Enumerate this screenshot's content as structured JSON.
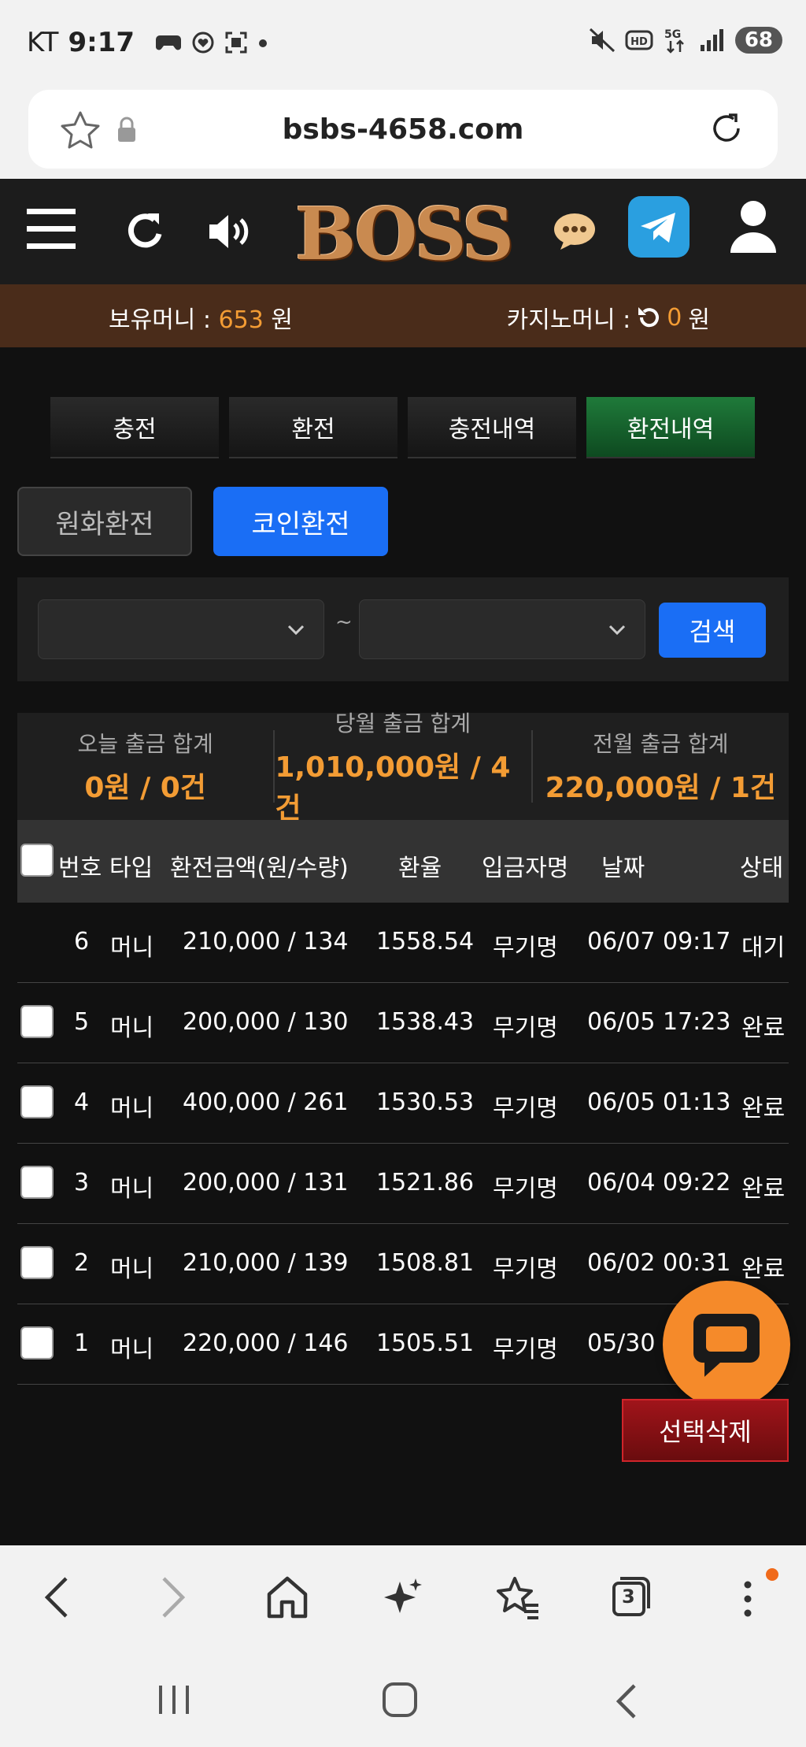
{
  "status_bar": {
    "carrier": "KT",
    "time": "9:17",
    "battery": "68"
  },
  "browser": {
    "url": "bsbs-4658.com",
    "tab_count": "3"
  },
  "header": {
    "logo_text": "BOSS"
  },
  "money": {
    "held_label": "보유머니 :",
    "held_value": "653",
    "held_unit": "원",
    "casino_label": "카지노머니 :",
    "casino_value": "0",
    "casino_unit": "원"
  },
  "tabs": [
    {
      "label": "충전",
      "active": false
    },
    {
      "label": "환전",
      "active": false
    },
    {
      "label": "충전내역",
      "active": false
    },
    {
      "label": "환전내역",
      "active": true
    }
  ],
  "subtabs": [
    {
      "label": "원화환전",
      "active": false
    },
    {
      "label": "코인환전",
      "active": true
    }
  ],
  "search": {
    "separator": "~",
    "button_label": "검색"
  },
  "summary": [
    {
      "label": "오늘 출금 합계",
      "value": "0원 / 0건"
    },
    {
      "label": "당월 출금 합계",
      "value": "1,010,000원 / 4건"
    },
    {
      "label": "전월 출금 합계",
      "value": "220,000원 / 1건"
    }
  ],
  "table": {
    "headers": [
      "번호",
      "타입",
      "환전금액(원/수량)",
      "환율",
      "입금자명",
      "날짜",
      "상태"
    ],
    "rows": [
      {
        "no": "6",
        "type": "머니",
        "amount": "210,000 / 134",
        "rate": "1558.54",
        "name": "무기명",
        "date": "06/07 09:17",
        "status": "대기",
        "checkbox": false
      },
      {
        "no": "5",
        "type": "머니",
        "amount": "200,000 / 130",
        "rate": "1538.43",
        "name": "무기명",
        "date": "06/05 17:23",
        "status": "완료",
        "checkbox": true
      },
      {
        "no": "4",
        "type": "머니",
        "amount": "400,000 / 261",
        "rate": "1530.53",
        "name": "무기명",
        "date": "06/05 01:13",
        "status": "완료",
        "checkbox": true
      },
      {
        "no": "3",
        "type": "머니",
        "amount": "200,000 / 131",
        "rate": "1521.86",
        "name": "무기명",
        "date": "06/04 09:22",
        "status": "완료",
        "checkbox": true
      },
      {
        "no": "2",
        "type": "머니",
        "amount": "210,000 / 139",
        "rate": "1508.81",
        "name": "무기명",
        "date": "06/02 00:31",
        "status": "완료",
        "checkbox": true
      },
      {
        "no": "1",
        "type": "머니",
        "amount": "220,000 / 146",
        "rate": "1505.51",
        "name": "무기명",
        "date": "05/30",
        "status": "",
        "checkbox": true
      }
    ]
  },
  "delete_button": "선택삭제",
  "colors": {
    "accent_orange": "#f39c34",
    "primary_blue": "#1a6ef5",
    "active_tab_green": "#1f7a3a",
    "delete_red": "#a0141a"
  }
}
